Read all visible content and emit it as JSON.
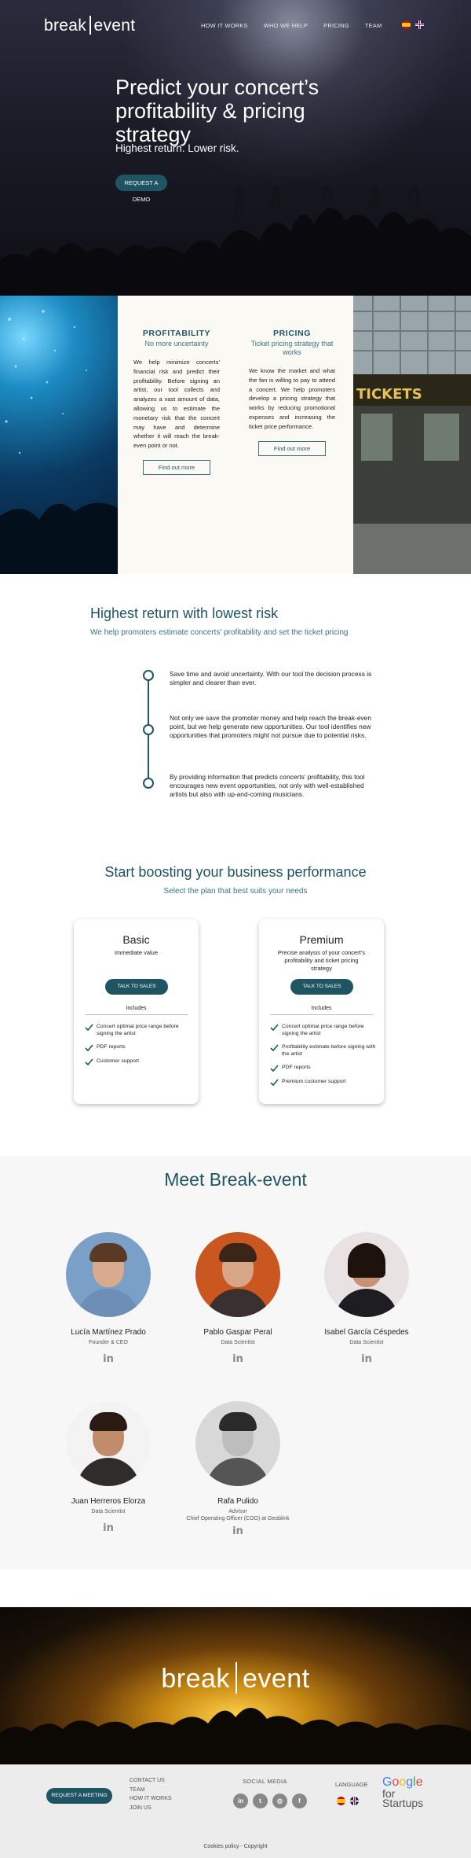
{
  "nav": {
    "logo_left": "break",
    "logo_right": "event",
    "links": [
      "HOW IT WORKS",
      "WHO WE HELP",
      "PRICING",
      "TEAM"
    ]
  },
  "hero": {
    "title": "Predict your concert’s profitability & pricing strategy",
    "subtitle": "Highest return. Lower risk.",
    "cta": "REQUEST A DEMO"
  },
  "features": {
    "profitability": {
      "title": "PROFITABILITY",
      "subtitle": "No more uncertainty",
      "body": "We help minimize concerts’ financial risk and predict their profitability. Before signing an artist, our tool collects and analyzes a vast amount of data, allowing us to estimate the monetary risk that the concert may have and determine whether it will reach the break-even point or not.",
      "button": "Find out more"
    },
    "pricing": {
      "title": "PRICING",
      "subtitle": "Ticket pricing strategy that works",
      "body": "We know the market and what the fan is willing to pay to attend a concert. We help promoters develop a pricing strategy that works by reducing promotional expenses and increasing the ticket price performance.",
      "button": "Find out more"
    },
    "tickets_sign": "TICKETS"
  },
  "risk": {
    "title": "Highest return with lowest risk",
    "subtitle": "We help promoters estimate concerts’ profitability and set the ticket pricing",
    "items": [
      "Save time and avoid uncertainty. With our tool the decision process is simpler and clearer than ever.",
      "Not only we save the promoter money and help reach the break-even point, but we help generate new opportunities. Our tool identifies new opportunities that promoters might not pursue due to potential risks.",
      "By providing information that predicts concerts’ profitability, this tool encourages new event opportunities, not only with well-established artists but also with up-and-coming musicians."
    ]
  },
  "pricing": {
    "title": "Start boosting your business performance",
    "subtitle": "Select the plan that best suits your needs",
    "plans": [
      {
        "name": "Basic",
        "desc": "Immediate value",
        "cta": "TALK TO SALES",
        "includes": "Includes",
        "features": [
          "Concert optimal price range before signing the artist",
          "PDF reports",
          "Customer support"
        ]
      },
      {
        "name": "Premium",
        "desc": "Precise analysis of your concert’s profitability and ticket pricing strategy",
        "cta": "TALK TO SALES",
        "includes": "Includes",
        "features": [
          "Concert optimal price range before signing the artist",
          "Profitability estimate before signing with the artist",
          "PDF reports",
          "Premium customer support"
        ]
      }
    ]
  },
  "team": {
    "title": "Meet Break-event",
    "members": [
      {
        "name": "Lucía Martínez Prado",
        "role": "Founder & CEO",
        "role2": ""
      },
      {
        "name": "Pablo Gaspar Peral",
        "role": "Data Scientist",
        "role2": ""
      },
      {
        "name": "Isabel García Céspedes",
        "role": "Data Scientist",
        "role2": ""
      },
      {
        "name": "Juan Herreros Elorza",
        "role": "Data Scientist",
        "role2": ""
      },
      {
        "name": "Rafa Pulido",
        "role": "Advisor",
        "role2": "Chief Operating Officer (COO) at Geoblink"
      }
    ],
    "linkedin_glyph": "in"
  },
  "banner": {
    "logo_left": "break",
    "logo_right": "event"
  },
  "footer": {
    "cta": "REQUEST A MEETING",
    "links": [
      "CONTACT US",
      "TEAM",
      "HOW IT WORKS",
      "JOIN US"
    ],
    "social_title": "SOCIAL MEDIA",
    "social_glyphs": [
      "in",
      "t",
      "◎",
      "f"
    ],
    "language_title": "LANGUAGE",
    "google_word": "Google",
    "google_line2": "for",
    "google_line3": "Startups",
    "copyright": "Cookies policy - Copyright"
  },
  "colors": {
    "accent": "#1f5563",
    "accent_light": "#3b7482"
  }
}
